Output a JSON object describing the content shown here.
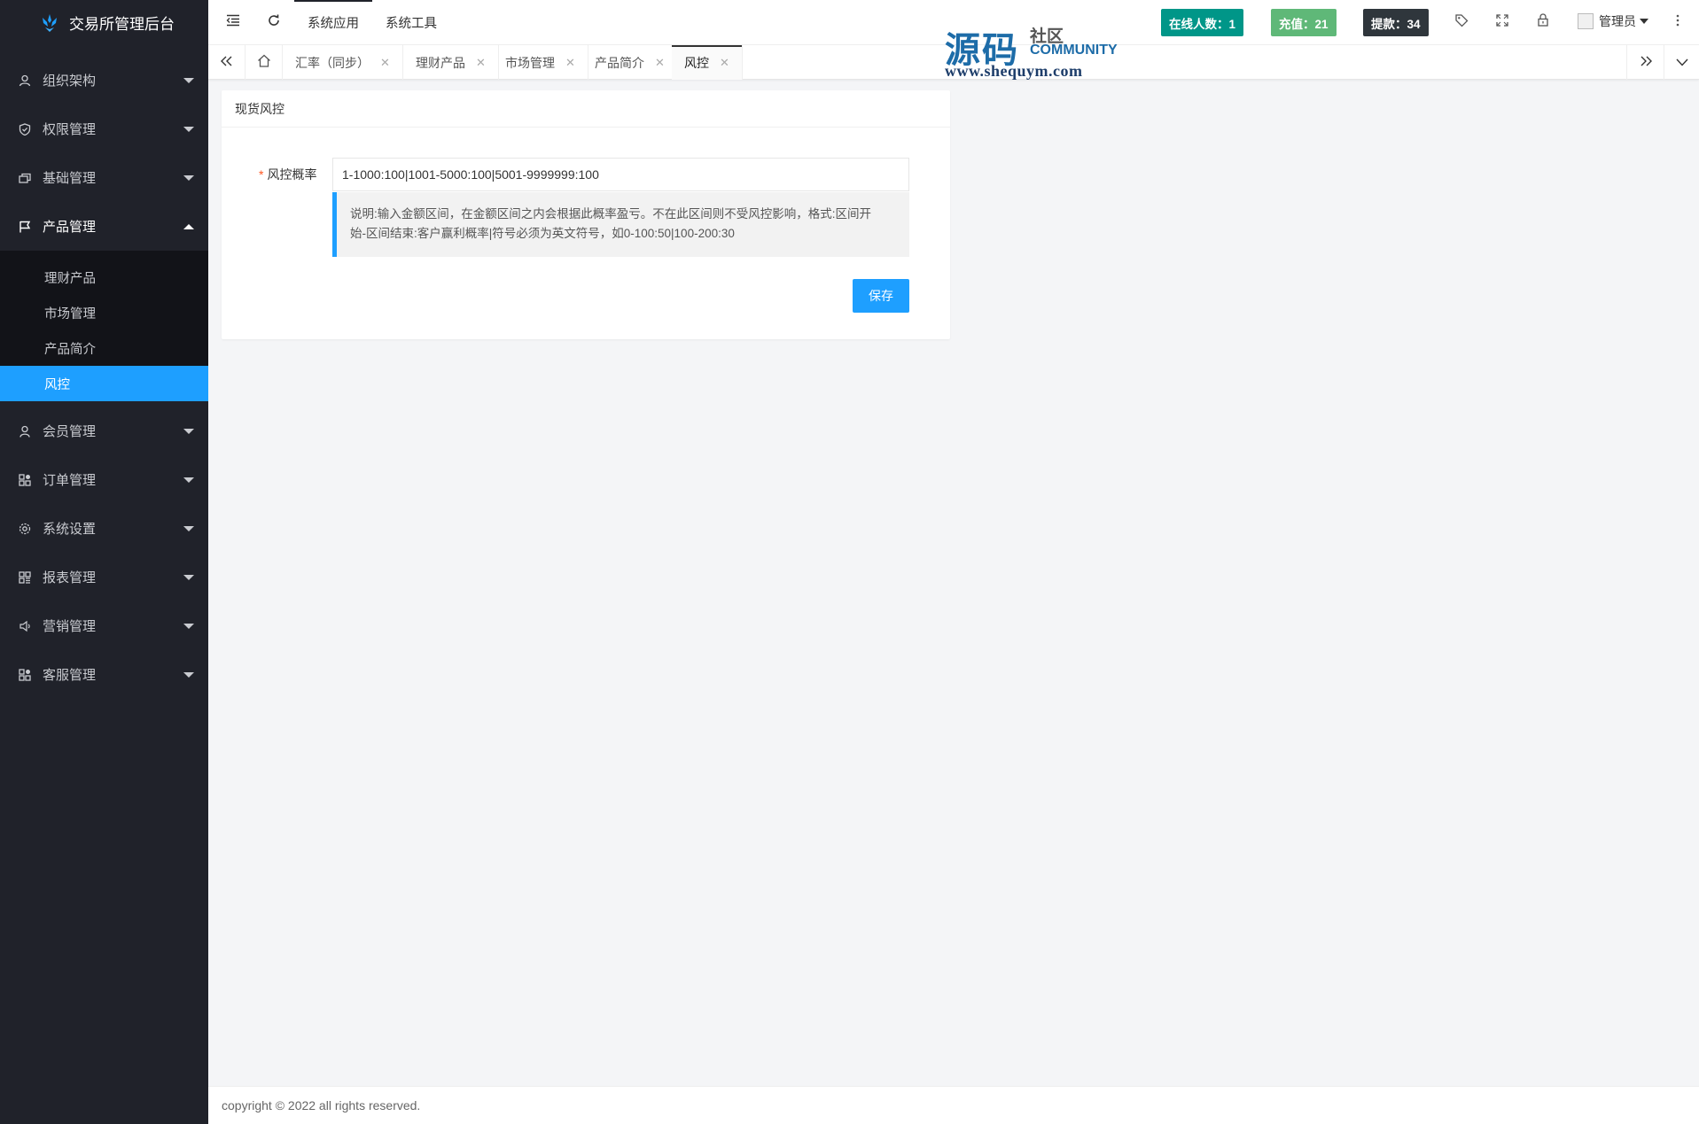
{
  "app": {
    "title": "交易所管理后台"
  },
  "sidebar": {
    "items": [
      {
        "label": "组织架构",
        "icon": "user-icon"
      },
      {
        "label": "权限管理",
        "icon": "shield-icon"
      },
      {
        "label": "基础管理",
        "icon": "layers-icon"
      },
      {
        "label": "产品管理",
        "icon": "flag-icon",
        "open": true,
        "children": [
          {
            "label": "理财产品"
          },
          {
            "label": "市场管理"
          },
          {
            "label": "产品简介"
          },
          {
            "label": "风控",
            "active": true
          }
        ]
      },
      {
        "label": "会员管理",
        "icon": "member-icon"
      },
      {
        "label": "订单管理",
        "icon": "apps-icon"
      },
      {
        "label": "系统设置",
        "icon": "gear-icon"
      },
      {
        "label": "报表管理",
        "icon": "grid-icon"
      },
      {
        "label": "营销管理",
        "icon": "speaker-icon"
      },
      {
        "label": "客服管理",
        "icon": "service-icon"
      }
    ]
  },
  "header": {
    "nav": [
      {
        "label": "系统应用"
      },
      {
        "label": "系统工具"
      }
    ],
    "badges": {
      "online": "在线人数：1",
      "recharge": "充值：21",
      "withdraw": "提款：34"
    },
    "user": "管理员"
  },
  "watermark": {
    "big": "源码",
    "small": "社区",
    "community": "COMMUNITY",
    "url": "www.shequym.com"
  },
  "tabs": [
    {
      "label": "汇率（同步）"
    },
    {
      "label": "理财产品"
    },
    {
      "label": "市场管理"
    },
    {
      "label": "产品简介"
    },
    {
      "label": "风控",
      "active": true
    }
  ],
  "card": {
    "title": "现货风控",
    "field_label": "风控概率",
    "field_value": "1-1000:100|1001-5000:100|5001-9999999:100",
    "note_line1": "说明:输入金额区间，在金额区间之内会根据此概率盈亏。不在此区间则不受风控影响，格式:区间开",
    "note_line2": "始-区间结束:客户赢利概率|符号必须为英文符号，如0-100:50|100-200:30",
    "save_label": "保存"
  },
  "footer": {
    "text": "copyright © 2022 all rights reserved."
  },
  "colors": {
    "sidebar_bg": "#20222a",
    "accent": "#1e9fff",
    "badge_online": "#009688",
    "badge_recharge": "#5fb878",
    "badge_withdraw": "#2f363c"
  }
}
